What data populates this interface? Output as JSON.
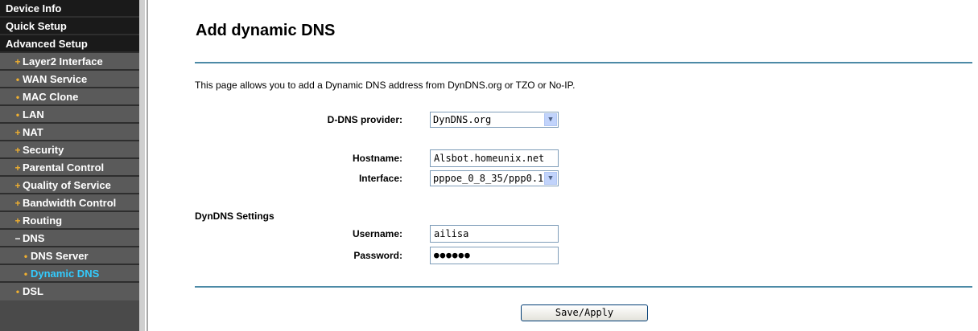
{
  "sidebar": {
    "items": [
      {
        "label": "Device Info",
        "bullet": ""
      },
      {
        "label": "Quick Setup",
        "bullet": ""
      },
      {
        "label": "Advanced Setup",
        "bullet": ""
      },
      {
        "label": "Layer2 Interface",
        "bullet": "+"
      },
      {
        "label": "WAN Service",
        "bullet": "•"
      },
      {
        "label": "MAC Clone",
        "bullet": "•"
      },
      {
        "label": "LAN",
        "bullet": "•"
      },
      {
        "label": "NAT",
        "bullet": "+"
      },
      {
        "label": "Security",
        "bullet": "+"
      },
      {
        "label": "Parental Control",
        "bullet": "+"
      },
      {
        "label": "Quality of Service",
        "bullet": "+"
      },
      {
        "label": "Bandwidth Control",
        "bullet": "+"
      },
      {
        "label": "Routing",
        "bullet": "+"
      },
      {
        "label": "DNS",
        "bullet": "−"
      },
      {
        "label": "DNS Server",
        "bullet": "•"
      },
      {
        "label": "Dynamic DNS",
        "bullet": "•"
      },
      {
        "label": "DSL",
        "bullet": "•"
      }
    ],
    "active": "Dynamic DNS",
    "active_color": "#33ccff"
  },
  "main": {
    "title": "Add dynamic DNS",
    "description": "This page allows you to add a Dynamic DNS address from DynDNS.org or TZO or No-IP.",
    "provider_label": "D-DNS provider:",
    "provider_value": "DynDNS.org",
    "hostname_label": "Hostname:",
    "hostname_value": "Alsbot.homeunix.net",
    "interface_label": "Interface:",
    "interface_value": "pppoe_0_8_35/ppp0.1",
    "section_label": "DynDNS Settings",
    "username_label": "Username:",
    "username_value": "ailisa",
    "password_label": "Password:",
    "password_value": "●●●●●●",
    "save_label": "Save/Apply",
    "rule_color": "#4c8aa6"
  }
}
